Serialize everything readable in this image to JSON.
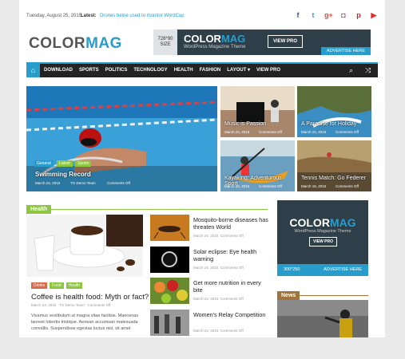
{
  "topbar": {
    "date": "Tuesday, August 25, 2015",
    "latest_label": "Latest:",
    "latest_news": "Drones beine used to monitor WordCup"
  },
  "social": [
    "facebook-icon",
    "twitter-icon",
    "googleplus-icon",
    "instagram-icon",
    "pinterest-icon",
    "youtube-icon"
  ],
  "logo": {
    "part1": "COLOR",
    "part2": "MAG"
  },
  "ad728": {
    "size": "728*90",
    "size_label": "SIZE",
    "logo1": "COLOR",
    "logo2": "MAG",
    "sub": "WordPress Magazine Theme",
    "button": "VIEW PRO",
    "footer": "ADVERTISE HERE"
  },
  "nav": {
    "items": [
      "DOWNLOAD",
      "SPORTS",
      "POLITICS",
      "TECHNOLOGY",
      "HEALTH",
      "FASHION",
      "LAYOUT ▾",
      "VIEW PRO"
    ]
  },
  "hero": {
    "title": "Swimming Record",
    "date": "March 24, 2015",
    "author": "TG Demo Team",
    "comments": "Comments Off",
    "cats": [
      "General",
      "Latest",
      "Sports"
    ]
  },
  "tiles": [
    {
      "title": "Music is Passion",
      "date": "March 24, 2015",
      "comments": "Comments Off"
    },
    {
      "title": "A Paradise for Holiday",
      "date": "March 24, 2015",
      "comments": "Comments Off"
    },
    {
      "title": "Kayaking: Adventurous Sport",
      "date": "March 20, 2015",
      "comments": "Comments Off"
    },
    {
      "title": "Tennis Match: Go Federer",
      "date": "March 19, 2015",
      "comments": "Comments Off"
    }
  ],
  "health": {
    "section": "Health",
    "featured": {
      "tags": [
        "Drinks",
        "Food",
        "Health"
      ],
      "title": "Coffee is health food: Myth or fact?",
      "date": "March 24, 2015",
      "author": "TG Demo Team",
      "comments": "Comments Off",
      "excerpt": "Vivamus vestibulum ut magna vitae facilisis. Maecenas laoreet lobortis tristique. Aenean accumsan malesuada convallis. Suspendisse egestas luctus nisl, sit amet"
    },
    "list": [
      {
        "title": "Mosquito-borne diseases has threaten World",
        "date": "March 24, 2015",
        "comments": "Comments Off"
      },
      {
        "title": "Solar eclipse: Eye health warning",
        "date": "March 24, 2015",
        "comments": "Comments Off"
      },
      {
        "title": "Get more nutrition in every bite",
        "date": "March 24, 2015",
        "comments": "Comments Off"
      },
      {
        "title": "Women's Relay Competition",
        "date": "March 24, 2015",
        "comments": "Comments Off"
      }
    ]
  },
  "ad300": {
    "logo1": "COLOR",
    "logo2": "MAG",
    "sub": "WordPress Magazine Theme",
    "button": "VIEW PRO",
    "size": "300*250",
    "footer": "ADVERTISE HERE"
  },
  "news": {
    "section": "News"
  }
}
